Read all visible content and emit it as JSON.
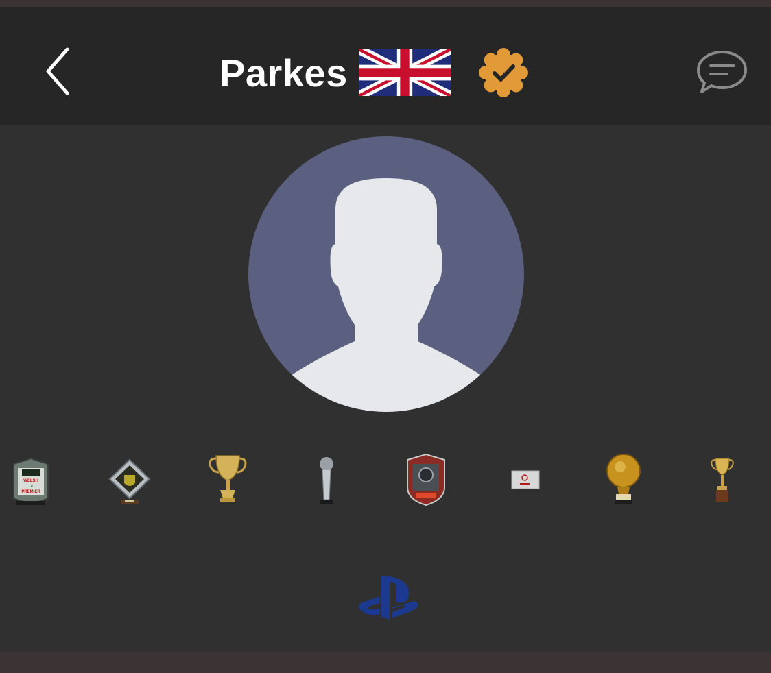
{
  "header": {
    "username": "Parkes",
    "country_flag_icon": "uk-flag-icon",
    "verified_icon": "verified-badge-icon",
    "back_icon": "chevron-left-icon",
    "chat_icon": "chat-bubble-icon"
  },
  "avatar": {
    "icon": "default-user-silhouette-icon"
  },
  "trophies": [
    {
      "name": "welsh-premier-shield-trophy",
      "label": "WELSH PREMIER"
    },
    {
      "name": "diamond-crystal-trophy"
    },
    {
      "name": "gold-cup-trophy"
    },
    {
      "name": "silver-ball-pillar-trophy"
    },
    {
      "name": "shield-badge-trophy"
    },
    {
      "name": "card-trophy"
    },
    {
      "name": "golden-ball-trophy"
    },
    {
      "name": "small-gold-cup-trophy"
    }
  ],
  "platform": {
    "icon": "playstation-icon"
  },
  "colors": {
    "background": "#303030",
    "header": "#262626",
    "avatar_bg": "#5b6080",
    "avatar_fg": "#e6e8eb",
    "verified": "#e29a38",
    "playstation": "#1b3a8f"
  }
}
